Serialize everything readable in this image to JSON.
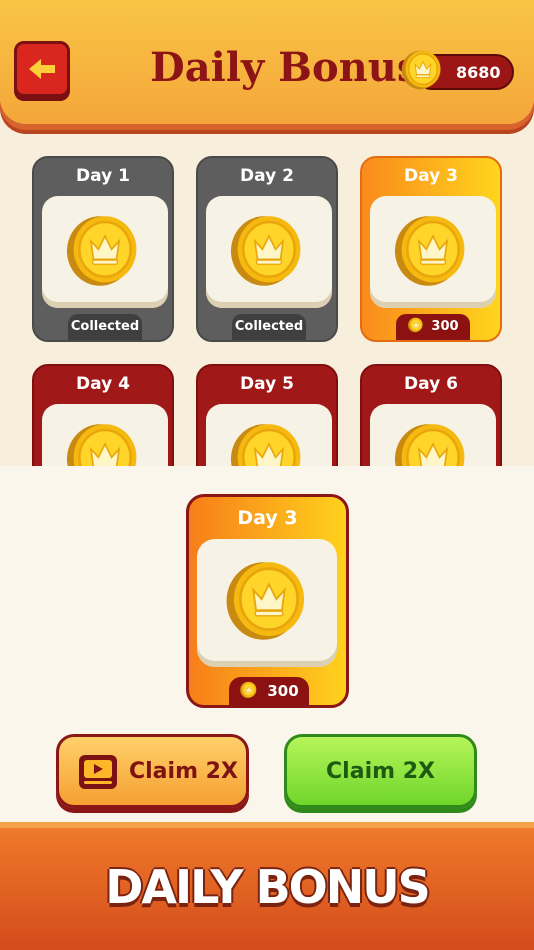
{
  "header": {
    "title": "Daily Bonus",
    "coins": "8680"
  },
  "days": [
    {
      "label": "Day 1",
      "status": "Collected",
      "state": "collected"
    },
    {
      "label": "Day 2",
      "status": "Collected",
      "state": "collected"
    },
    {
      "label": "Day 3",
      "status": "300",
      "state": "current"
    },
    {
      "label": "Day 4",
      "state": "upcoming"
    },
    {
      "label": "Day 5",
      "state": "upcoming"
    },
    {
      "label": "Day 6",
      "state": "upcoming"
    }
  ],
  "featured": {
    "label": "Day 3",
    "amount": "300"
  },
  "buttons": {
    "claim_video": "Claim 2X",
    "claim": "Claim 2X"
  },
  "footer": {
    "banner": "DAILY BONUS"
  },
  "colors": {
    "accent": "#a01818",
    "gold": "#ffd51d",
    "green": "#6fd62a"
  }
}
